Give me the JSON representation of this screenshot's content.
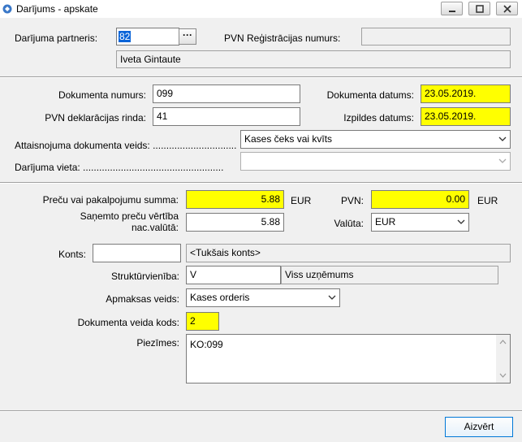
{
  "window": {
    "title": "Darījums - apskate"
  },
  "partner": {
    "label": "Darījuma partneris:",
    "code": "82",
    "browse_label": "···",
    "name": "Iveta Gintaute",
    "vat_reg_label": "PVN Reģistrācijas numurs:",
    "vat_reg_value": ""
  },
  "document": {
    "number_label": "Dokumenta numurs:",
    "number": "099",
    "date_label": "Dokumenta datums:",
    "date": "23.05.2019.",
    "vat_row_label": "PVN deklarācijas rinda:",
    "vat_row": "41",
    "exec_date_label": "Izpildes datums:",
    "exec_date": "23.05.2019.",
    "justification_label": "Attaisnojuma dokumenta veids: ...............................",
    "justification": "Kases čeks vai kvīts",
    "place_label": "Darījuma vieta: ....................................................",
    "place": ""
  },
  "amounts": {
    "sum_label": "Preču vai pakalpojumu summa:",
    "sum": "5.88",
    "sum_currency": "EUR",
    "vat_label": "PVN:",
    "vat": "0.00",
    "vat_currency": "EUR",
    "received_label_1": "Saņemto preču vērtība",
    "received_label_2": "nac.valūtā:",
    "received": "5.88",
    "currency_label": "Valūta:",
    "currency": "EUR"
  },
  "account": {
    "label": "Konts:",
    "value": "",
    "name": "<Tukšais konts>",
    "struct_label": "Struktūrvienība:",
    "struct_code": "V",
    "struct_name": "Viss uzņēmums",
    "payment_label": "Apmaksas veids:",
    "payment": "Kases orderis",
    "doc_type_label": "Dokumenta veida kods:",
    "doc_type": "2",
    "notes_label": "Piezīmes:",
    "notes": "KO:099"
  },
  "footer": {
    "close_label": "Aizvērt"
  }
}
